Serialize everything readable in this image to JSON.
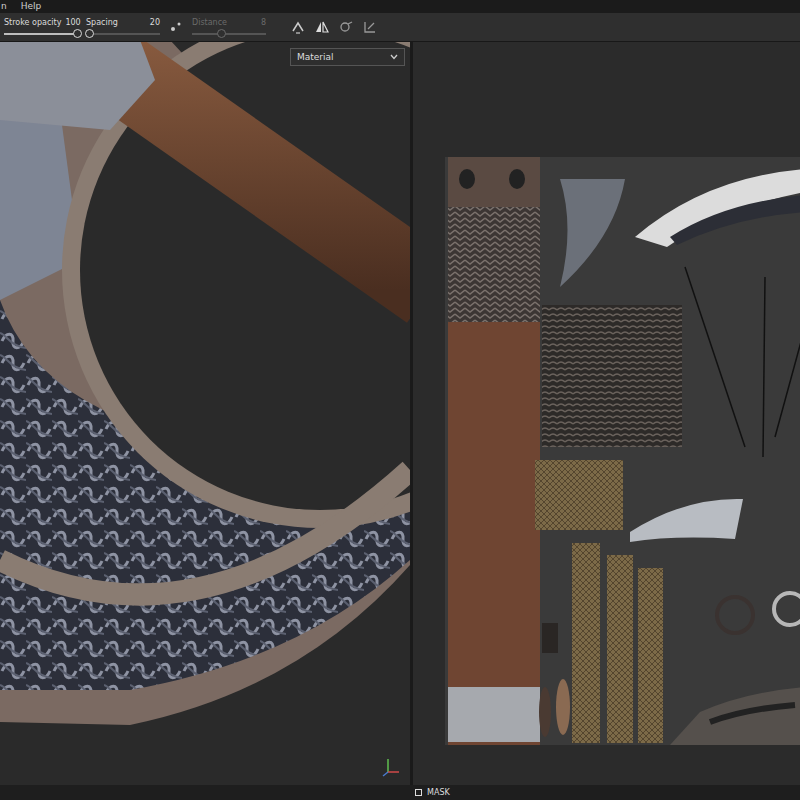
{
  "menu": [
    {
      "label": "n"
    },
    {
      "label": "Help"
    }
  ],
  "toolbar": {
    "sliders": [
      {
        "label": "Stroke opacity",
        "value": "100",
        "level": 1,
        "disabled": false
      },
      {
        "label": "Spacing",
        "value": "20",
        "level": 0.05,
        "disabled": false
      },
      {
        "label": "Distance",
        "value": "8",
        "level": 0.4,
        "disabled": true
      }
    ]
  },
  "viewport": {
    "channel_dropdown": "Material"
  },
  "status_bar": {
    "mask": {
      "label": "MASK",
      "checked": false
    }
  }
}
